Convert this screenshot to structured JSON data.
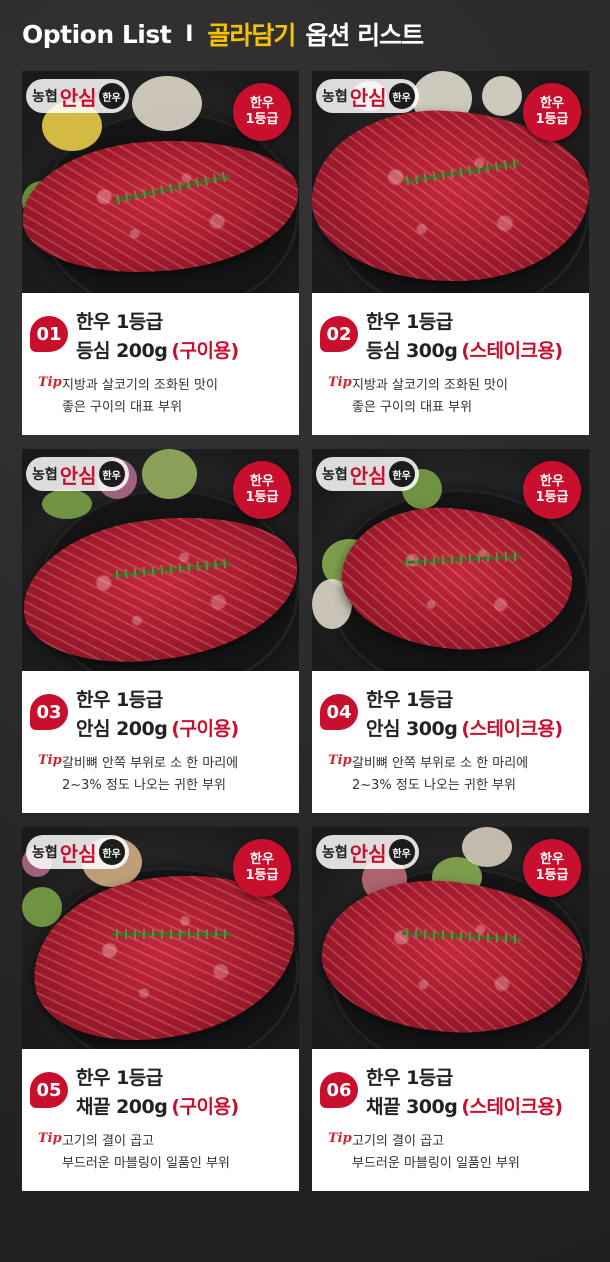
{
  "header": {
    "english": "Option List",
    "separator": "I",
    "highlight": "골라담기",
    "korean": "옵션 리스트"
  },
  "badge": {
    "line1": "한우",
    "line2": "1등급"
  },
  "logo": {
    "prefix": "농협",
    "main": "안심",
    "circle": "한우"
  },
  "tip_label": "Tip",
  "colors": {
    "accent": "#c8102e",
    "header_highlight": "#f6c200",
    "background": "#2a2a2a"
  },
  "options": [
    {
      "num": "01",
      "line1": "한우 1등급",
      "cut": "등심 200g",
      "use": "(구이용)",
      "tip1": "지방과 살코기의 조화된 맛이",
      "tip2": "좋은 구이의 대표 부위"
    },
    {
      "num": "02",
      "line1": "한우 1등급",
      "cut": "등심 300g",
      "use": "(스테이크용)",
      "tip1": "지방과 살코기의 조화된 맛이",
      "tip2": "좋은 구이의 대표 부위"
    },
    {
      "num": "03",
      "line1": "한우 1등급",
      "cut": "안심 200g",
      "use": "(구이용)",
      "tip1": "갈비뼈 안쪽 부위로 소 한 마리에",
      "tip2": "2~3% 정도 나오는 귀한 부위"
    },
    {
      "num": "04",
      "line1": "한우 1등급",
      "cut": "안심 300g",
      "use": "(스테이크용)",
      "tip1": "갈비뼈 안쪽 부위로 소 한 마리에",
      "tip2": "2~3% 정도 나오는 귀한 부위"
    },
    {
      "num": "05",
      "line1": "한우 1등급",
      "cut": "채끝 200g",
      "use": "(구이용)",
      "tip1": "고기의 결이 곱고",
      "tip2": "부드러운 마블링이 일품인 부위"
    },
    {
      "num": "06",
      "line1": "한우 1등급",
      "cut": "채끝 300g",
      "use": "(스테이크용)",
      "tip1": "고기의 결이 곱고",
      "tip2": "부드러운 마블링이 일품인 부위"
    }
  ]
}
